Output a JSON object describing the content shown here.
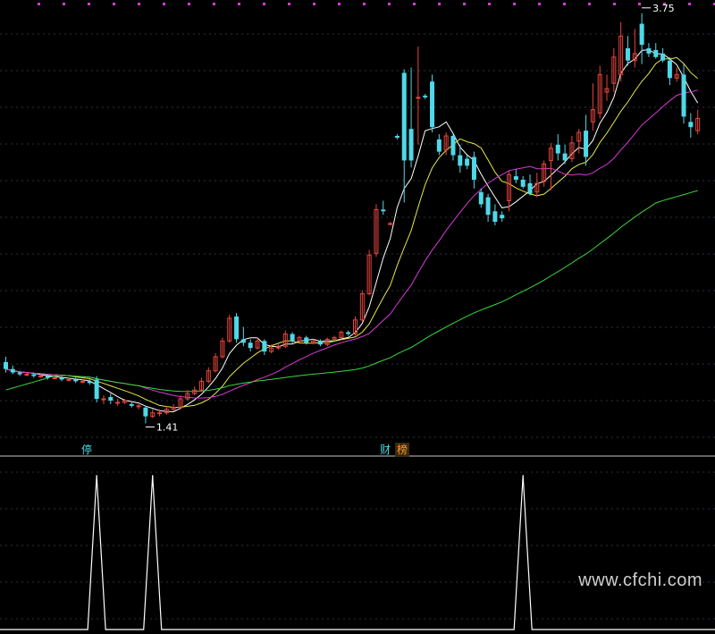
{
  "colors": {
    "background": "#000000",
    "grid": "#2a3340",
    "up": "#e8453c",
    "down": "#4fd8e8",
    "ma_short": "#ffffff",
    "ma_mid": "#e8e84a",
    "ma_long": "#d63ad6",
    "ma_xlong": "#3cd63c",
    "marker": "#d63ad6",
    "label_text": "#ffffff",
    "signal_line": "#ffffff"
  },
  "badges": {
    "ting": "停",
    "cai": "财",
    "bang": "榜"
  },
  "watermark": "www.cfchi.com",
  "chart_data": [
    {
      "type": "candlestick",
      "title": "",
      "price_range": [
        1.3,
        3.8
      ],
      "grid": true,
      "annotations": [
        {
          "index": 91,
          "price": 3.75,
          "label": "3.75"
        },
        {
          "index": 20,
          "price": 1.41,
          "label": "1.41"
        }
      ],
      "candles": [
        [
          1.76,
          1.72,
          1.79,
          1.7
        ],
        [
          1.72,
          1.7,
          1.74,
          1.69
        ],
        [
          1.7,
          1.69,
          1.71,
          1.68
        ],
        [
          1.69,
          1.69,
          1.7,
          1.68
        ],
        [
          1.69,
          1.68,
          1.7,
          1.67
        ],
        [
          1.68,
          1.68,
          1.69,
          1.67
        ],
        [
          1.68,
          1.67,
          1.69,
          1.66
        ],
        [
          1.67,
          1.67,
          1.68,
          1.66
        ],
        [
          1.67,
          1.66,
          1.68,
          1.65
        ],
        [
          1.66,
          1.66,
          1.67,
          1.65
        ],
        [
          1.66,
          1.65,
          1.67,
          1.64
        ],
        [
          1.65,
          1.65,
          1.66,
          1.64
        ],
        [
          1.65,
          1.64,
          1.66,
          1.63
        ],
        [
          1.66,
          1.55,
          1.68,
          1.53
        ],
        [
          1.55,
          1.55,
          1.57,
          1.52
        ],
        [
          1.56,
          1.54,
          1.58,
          1.52
        ],
        [
          1.53,
          1.53,
          1.55,
          1.51
        ],
        [
          1.53,
          1.54,
          1.55,
          1.52
        ],
        [
          1.52,
          1.51,
          1.53,
          1.5
        ],
        [
          1.51,
          1.51,
          1.52,
          1.49
        ],
        [
          1.5,
          1.45,
          1.51,
          1.41
        ],
        [
          1.45,
          1.47,
          1.49,
          1.44
        ],
        [
          1.47,
          1.47,
          1.49,
          1.45
        ],
        [
          1.47,
          1.49,
          1.51,
          1.46
        ],
        [
          1.49,
          1.5,
          1.52,
          1.48
        ],
        [
          1.5,
          1.55,
          1.57,
          1.49
        ],
        [
          1.55,
          1.58,
          1.6,
          1.54
        ],
        [
          1.58,
          1.6,
          1.62,
          1.57
        ],
        [
          1.6,
          1.65,
          1.67,
          1.59
        ],
        [
          1.65,
          1.71,
          1.73,
          1.64
        ],
        [
          1.71,
          1.79,
          1.81,
          1.7
        ],
        [
          1.79,
          1.88,
          1.9,
          1.78
        ],
        [
          1.88,
          2.01,
          2.03,
          1.87
        ],
        [
          2.02,
          1.89,
          2.04,
          1.87
        ],
        [
          1.89,
          1.87,
          1.96,
          1.85
        ],
        [
          1.87,
          1.84,
          1.89,
          1.82
        ],
        [
          1.84,
          1.88,
          1.9,
          1.83
        ],
        [
          1.88,
          1.82,
          1.89,
          1.8
        ],
        [
          1.82,
          1.84,
          1.86,
          1.81
        ],
        [
          1.84,
          1.85,
          1.86,
          1.83
        ],
        [
          1.85,
          1.92,
          1.94,
          1.84
        ],
        [
          1.92,
          1.88,
          1.93,
          1.86
        ],
        [
          1.88,
          1.9,
          1.91,
          1.87
        ],
        [
          1.9,
          1.87,
          1.91,
          1.86
        ],
        [
          1.87,
          1.88,
          1.89,
          1.86
        ],
        [
          1.88,
          1.86,
          1.89,
          1.85
        ],
        [
          1.86,
          1.89,
          1.9,
          1.85
        ],
        [
          1.89,
          1.9,
          1.91,
          1.88
        ],
        [
          1.9,
          1.93,
          1.94,
          1.89
        ],
        [
          1.93,
          1.92,
          1.94,
          1.91
        ],
        [
          1.92,
          2.0,
          2.02,
          1.91
        ],
        [
          2.0,
          2.15,
          2.17,
          1.99
        ],
        [
          2.15,
          2.37,
          2.4,
          2.14
        ],
        [
          2.38,
          2.63,
          2.66,
          2.36
        ],
        [
          2.63,
          2.62,
          2.68,
          2.6
        ],
        [
          2.55,
          2.55,
          2.56,
          2.54
        ],
        [
          3.05,
          3.04,
          3.06,
          3.03
        ],
        [
          3.41,
          2.91,
          3.43,
          2.67
        ],
        [
          3.09,
          2.91,
          3.44,
          2.87
        ],
        [
          3.27,
          3.27,
          3.56,
          3.0
        ],
        [
          3.28,
          3.27,
          3.29,
          3.26
        ],
        [
          3.36,
          3.1,
          3.4,
          3.07
        ],
        [
          3.03,
          2.96,
          3.06,
          2.94
        ],
        [
          2.97,
          3.05,
          3.07,
          2.94
        ],
        [
          3.05,
          2.94,
          3.06,
          2.91
        ],
        [
          2.94,
          2.88,
          3.0,
          2.84
        ],
        [
          2.92,
          2.88,
          2.94,
          2.86
        ],
        [
          2.93,
          2.8,
          2.96,
          2.75
        ],
        [
          2.73,
          2.66,
          2.75,
          2.64
        ],
        [
          2.7,
          2.6,
          2.72,
          2.56
        ],
        [
          2.62,
          2.56,
          2.66,
          2.54
        ],
        [
          2.6,
          2.58,
          2.62,
          2.56
        ],
        [
          2.68,
          2.83,
          2.85,
          2.62
        ],
        [
          2.82,
          2.8,
          2.86,
          2.78
        ],
        [
          2.8,
          2.76,
          2.82,
          2.75
        ],
        [
          2.78,
          2.72,
          2.83,
          2.71
        ],
        [
          2.73,
          2.78,
          2.84,
          2.7
        ],
        [
          2.79,
          2.89,
          2.91,
          2.76
        ],
        [
          2.91,
          2.98,
          3.01,
          2.74
        ],
        [
          3.0,
          2.95,
          3.06,
          2.91
        ],
        [
          2.95,
          2.91,
          3.0,
          2.89
        ],
        [
          2.92,
          3.01,
          3.05,
          2.9
        ],
        [
          3.02,
          3.07,
          3.09,
          2.95
        ],
        [
          3.08,
          2.93,
          3.17,
          2.88
        ],
        [
          3.13,
          3.2,
          3.35,
          3.08
        ],
        [
          3.18,
          3.4,
          3.45,
          3.15
        ],
        [
          3.3,
          3.32,
          3.4,
          3.25
        ],
        [
          3.35,
          3.5,
          3.55,
          3.3
        ],
        [
          3.4,
          3.62,
          3.7,
          3.36
        ],
        [
          3.55,
          3.48,
          3.62,
          3.45
        ],
        [
          3.48,
          3.52,
          3.66,
          3.44
        ],
        [
          3.69,
          3.57,
          3.75,
          3.46
        ],
        [
          3.55,
          3.52,
          3.58,
          3.5
        ],
        [
          3.54,
          3.5,
          3.58,
          3.49
        ],
        [
          3.52,
          3.48,
          3.55,
          3.47
        ],
        [
          3.48,
          3.38,
          3.5,
          3.34
        ],
        [
          3.38,
          3.4,
          3.44,
          3.36
        ],
        [
          3.4,
          3.16,
          3.46,
          3.12
        ],
        [
          3.13,
          3.1,
          3.18,
          3.04
        ],
        [
          3.08,
          3.15,
          3.2,
          3.06
        ]
      ]
    },
    {
      "type": "line",
      "title": "",
      "ylim": [
        0,
        1
      ],
      "grid": true,
      "spike_indices": [
        13,
        21,
        74
      ],
      "values_note": ""
    }
  ]
}
